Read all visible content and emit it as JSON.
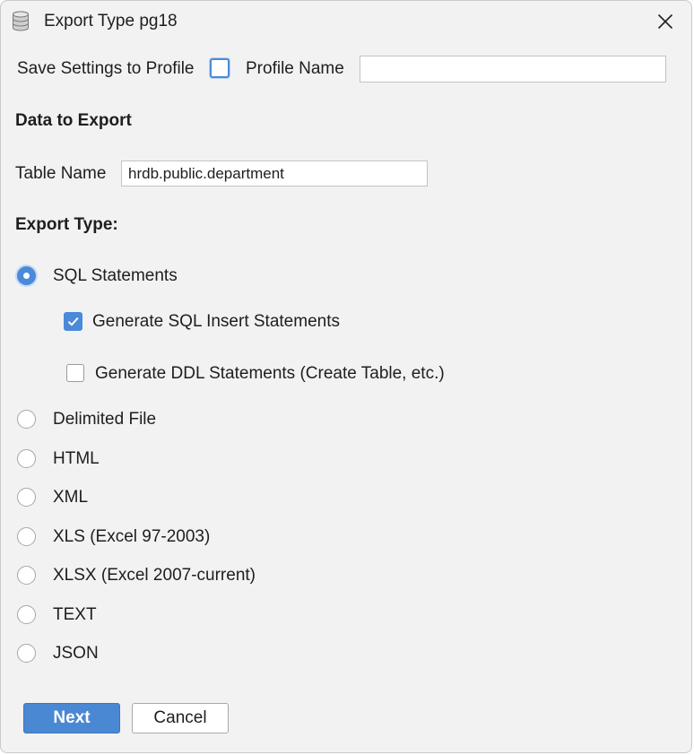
{
  "window": {
    "title": "Export Type pg18"
  },
  "profile": {
    "save_label": "Save Settings to Profile",
    "save_checked": false,
    "name_label": "Profile Name",
    "name_value": ""
  },
  "data_section": {
    "heading": "Data to Export",
    "table_name_label": "Table Name",
    "table_name_value": "hrdb.public.department"
  },
  "export_type": {
    "heading": "Export Type:",
    "selected": "SQL Statements",
    "sql_options": [
      {
        "label": "Generate SQL Insert Statements",
        "checked": true
      },
      {
        "label": "Generate DDL Statements (Create Table, etc.)",
        "checked": false
      }
    ],
    "options": [
      {
        "label": "SQL Statements"
      },
      {
        "label": "Delimited File"
      },
      {
        "label": "HTML"
      },
      {
        "label": "XML"
      },
      {
        "label": "XLS (Excel 97-2003)"
      },
      {
        "label": "XLSX (Excel 2007-current)"
      },
      {
        "label": "TEXT"
      },
      {
        "label": "JSON"
      }
    ]
  },
  "buttons": {
    "next": "Next",
    "cancel": "Cancel"
  },
  "colors": {
    "accent": "#4a8ad8",
    "background": "#f2f2f2"
  },
  "icons": {
    "title": "database-icon",
    "close": "close-icon"
  }
}
